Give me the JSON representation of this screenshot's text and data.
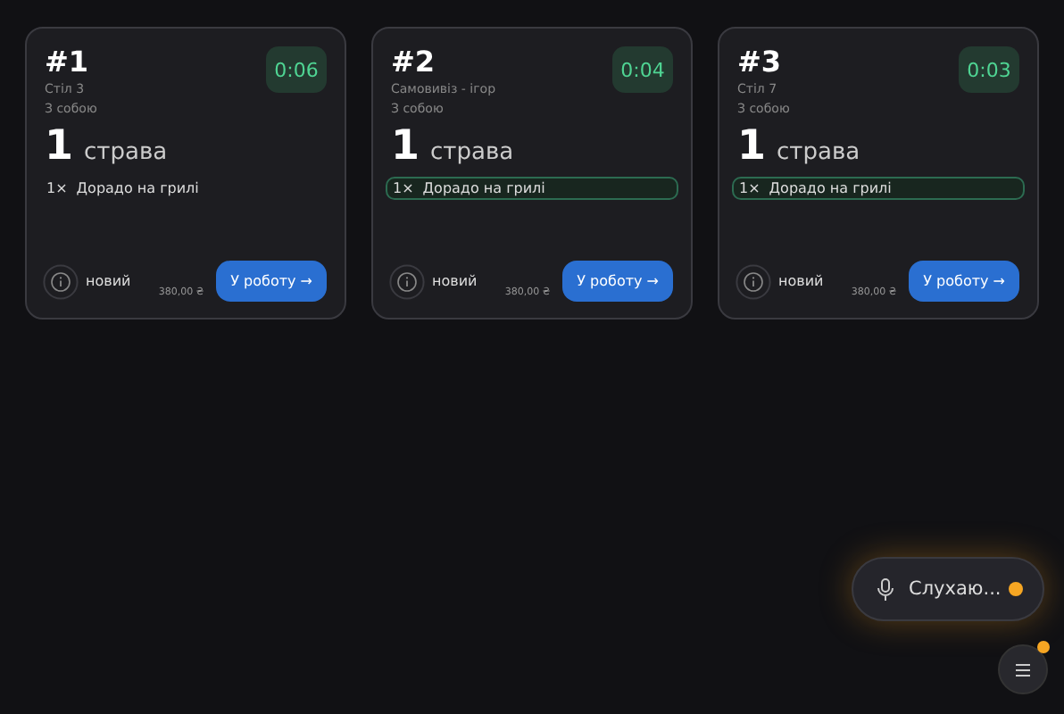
{
  "orders": [
    {
      "number": "#1",
      "table": "Стіл 3",
      "mode": "З собою",
      "count": "1",
      "count_label": "страва",
      "items": [
        {
          "qty": "1×",
          "name": "Дорадо на грилі",
          "highlighted": false
        }
      ],
      "timer": "0:06",
      "status": "новий",
      "total": "380,00 ₴",
      "action": "У роботу →"
    },
    {
      "number": "#2",
      "table": "Самовивіз - ігор",
      "mode": "З собою",
      "count": "1",
      "count_label": "страва",
      "items": [
        {
          "qty": "1×",
          "name": "Дорадо на грилі",
          "highlighted": true
        }
      ],
      "timer": "0:04",
      "status": "новий",
      "total": "380,00 ₴",
      "action": "У роботу →"
    },
    {
      "number": "#3",
      "table": "Стіл 7",
      "mode": "З собою",
      "count": "1",
      "count_label": "страва",
      "items": [
        {
          "qty": "1×",
          "name": "Дорадо на грилі",
          "highlighted": true
        }
      ],
      "timer": "0:03",
      "status": "новий",
      "total": "380,00 ₴",
      "action": "У роботу →"
    }
  ],
  "voice": {
    "label": "Слухаю...",
    "listening": true
  },
  "menu_button": {
    "notification": true
  }
}
